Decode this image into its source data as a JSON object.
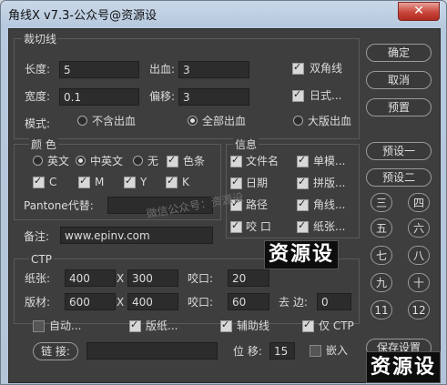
{
  "window": {
    "title": "角线X v7.3-公众号@资源设",
    "close_label": "✕"
  },
  "cut": {
    "group_label": "裁切线",
    "length_label": "长度:",
    "length_value": "5",
    "width_label": "宽度:",
    "width_value": "0.1",
    "bleed_label": "出血:",
    "bleed_value": "3",
    "offset_label": "偏移:",
    "offset_value": "3",
    "double_label": "双角线",
    "japanese_label": "日式...",
    "mode_label": "模式:",
    "modes": [
      "不含出血",
      "全部出血",
      "大版出血"
    ],
    "mode_selected": 1
  },
  "color": {
    "group_label": "颜 色",
    "langs": [
      "英文",
      "中英文",
      "无"
    ],
    "lang_selected": 1,
    "colorbar_label": "色条",
    "channels": [
      "C",
      "M",
      "Y",
      "K"
    ],
    "pantone_label": "Pantone代替:",
    "pantone_value": ""
  },
  "info": {
    "group_label": "信息",
    "items": [
      "文件名",
      "单模...",
      "日期",
      "拼版...",
      "路径",
      "角线...",
      "咬 口",
      "纸张..."
    ]
  },
  "note": {
    "label": "备注:",
    "value": "www.epinv.com"
  },
  "ctp": {
    "group_label": "CTP",
    "paper_label": "纸张:",
    "paper_w": "400",
    "paper_x": "X",
    "paper_h": "300",
    "bite1_label": "咬口:",
    "bite1_value": "20",
    "plate_label": "版材:",
    "plate_w": "600",
    "plate_x": "X",
    "plate_h": "400",
    "bite2_label": "咬口:",
    "bite2_value": "60",
    "margin_label": "去 边:",
    "margin_value": "0"
  },
  "options": {
    "auto_label": "自动...",
    "paper_label": "版纸...",
    "aux_label": "辅助线",
    "ctp_only_label": "仅 CTP"
  },
  "link": {
    "button_label": "链 接:",
    "value": "",
    "shift_label": "位 移:",
    "shift_value": "15",
    "embed_label": "嵌入"
  },
  "buttons": {
    "ok": "确定",
    "cancel": "取消",
    "preset": "预置",
    "preset1": "预设一",
    "preset2": "预设二",
    "save": "保存设置"
  },
  "number_buttons": [
    "三",
    "四",
    "五",
    "六",
    "七",
    "八",
    "九",
    "十",
    "11",
    "12"
  ],
  "watermark": {
    "text": "资源设",
    "faint": "微信公众号：资源设"
  }
}
